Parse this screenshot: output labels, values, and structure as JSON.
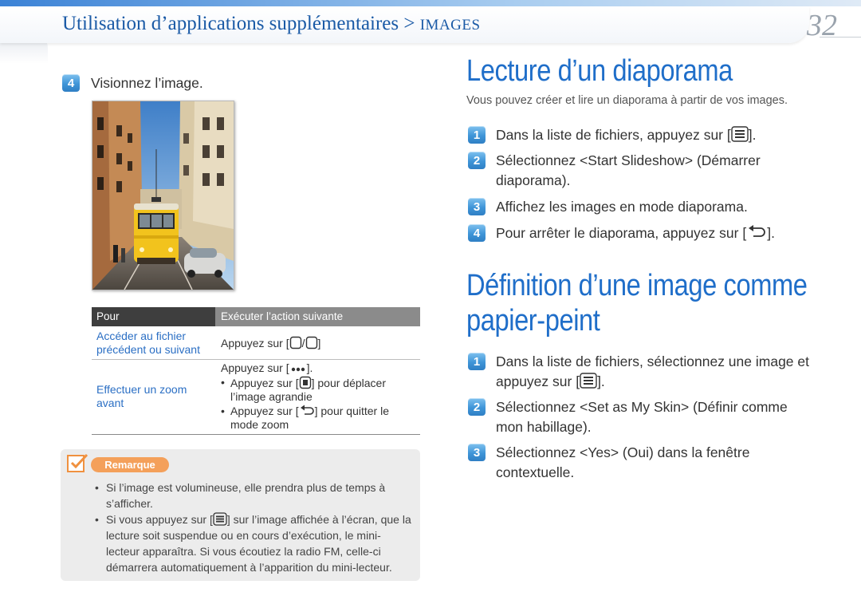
{
  "header": {
    "breadcrumb": "Utilisation d’applications supplémentaires > ",
    "section": "IMAGES",
    "page_number": "32"
  },
  "left": {
    "step4_num": "4",
    "step4_text": "Visionnez l’image.",
    "table": {
      "col1": "Pour",
      "col2": "Exécuter l’action suivante",
      "rows": [
        {
          "a": "Accéder au fichier précédent ou suivant",
          "b_prefix": "Appuyez sur [",
          "b_sep": "/",
          "b_suffix": "]"
        },
        {
          "a": "Effectuer un zoom avant",
          "b1_prefix": "Appuyez sur [",
          "b1_suffix": "].",
          "bullet1_prefix": "Appuyez sur [",
          "bullet1_suffix": "] pour déplacer l’image agrandie",
          "bullet2_prefix": "Appuyez sur [",
          "bullet2_suffix": "] pour quitter le mode zoom"
        }
      ]
    },
    "note": {
      "label": "Remarque",
      "items": [
        "Si l’image est volumineuse, elle prendra plus de temps à s’afficher.",
        "Si vous appuyez sur [",
        "] sur l’image affichée à l’écran, que la lecture soit suspendue ou en cours d’exécution, le mini-lecteur apparaîtra. Si vous écoutiez la radio FM, celle-ci démarrera automatiquement à l’apparition du mini-lecteur."
      ]
    }
  },
  "right": {
    "slideshow": {
      "title": "Lecture d’un diaporama",
      "intro": "Vous pouvez créer et lire un diaporama à partir de vos images.",
      "steps": [
        {
          "num": "1",
          "text": "Dans la liste de fichiers, appuyez sur [",
          "suffix": "]."
        },
        {
          "num": "2",
          "text": "Sélectionnez <Start Slideshow> (Démarrer diaporama)."
        },
        {
          "num": "3",
          "text": "Affichez les images en mode diaporama."
        },
        {
          "num": "4",
          "text": "Pour arrêter le diaporama, appuyez sur [",
          "suffix": "]."
        }
      ]
    },
    "wallpaper": {
      "title_line1": "Définition d’une image comme",
      "title_line2": "papier-peint",
      "steps": [
        {
          "num": "1",
          "text": "Dans la liste de fichiers, sélectionnez une image et appuyez sur [",
          "suffix": "]."
        },
        {
          "num": "2",
          "text": "Sélectionnez <Set as My Skin> (Définir comme mon habillage)."
        },
        {
          "num": "3",
          "text": "Sélectionnez <Yes> (Oui) dans la fenêtre contextuelle."
        }
      ]
    }
  },
  "colors": {
    "accent": "#1f6ec9",
    "badge": "#3f95d8",
    "note_label": "#f4a05a"
  },
  "icons": [
    "menu-icon",
    "back-icon",
    "prev-icon",
    "next-icon",
    "more-icon",
    "move-icon",
    "note-icon"
  ]
}
